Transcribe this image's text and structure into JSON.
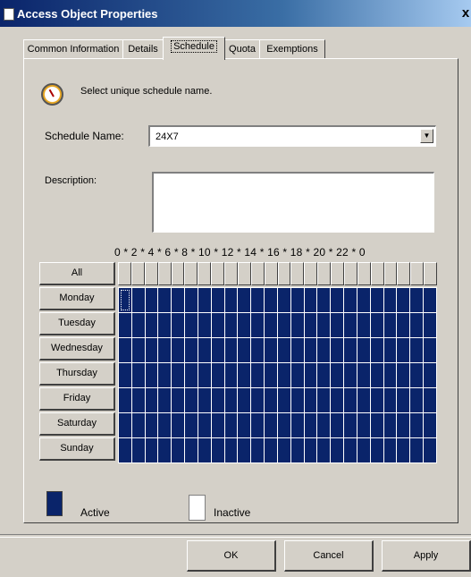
{
  "window": {
    "title": "Access Object Properties",
    "close_glyph": "x"
  },
  "tabs": [
    {
      "label": "Common Information"
    },
    {
      "label": "Details"
    },
    {
      "label": "Schedule"
    },
    {
      "label": "Quota"
    },
    {
      "label": "Exemptions"
    }
  ],
  "active_tab": "Schedule",
  "schedule": {
    "hint": "Select unique schedule name.",
    "name_label": "Schedule Name:",
    "name_value": "24X7",
    "description_label": "Description:",
    "description_value": "",
    "hours_header": "0 * 2 * 4 * 6 * 8 * 10 * 12 * 14 * 16 * 18 * 20 * 22 * 0",
    "all_label": "All",
    "days": [
      {
        "label": "Monday"
      },
      {
        "label": "Tuesday"
      },
      {
        "label": "Wednesday"
      },
      {
        "label": "Thursday"
      },
      {
        "label": "Friday"
      },
      {
        "label": "Saturday"
      },
      {
        "label": "Sunday"
      }
    ],
    "all_hours_state": "active",
    "legend": {
      "active_label": "Active",
      "inactive_label": "Inactive"
    },
    "colors": {
      "active": "#0a246a",
      "inactive": "#ffffff"
    }
  },
  "buttons": {
    "ok": "OK",
    "cancel": "Cancel",
    "apply": "Apply"
  },
  "icons": {
    "window": "window-icon",
    "schedule": "clock-icon",
    "dropdown": "chevron-down-icon"
  }
}
